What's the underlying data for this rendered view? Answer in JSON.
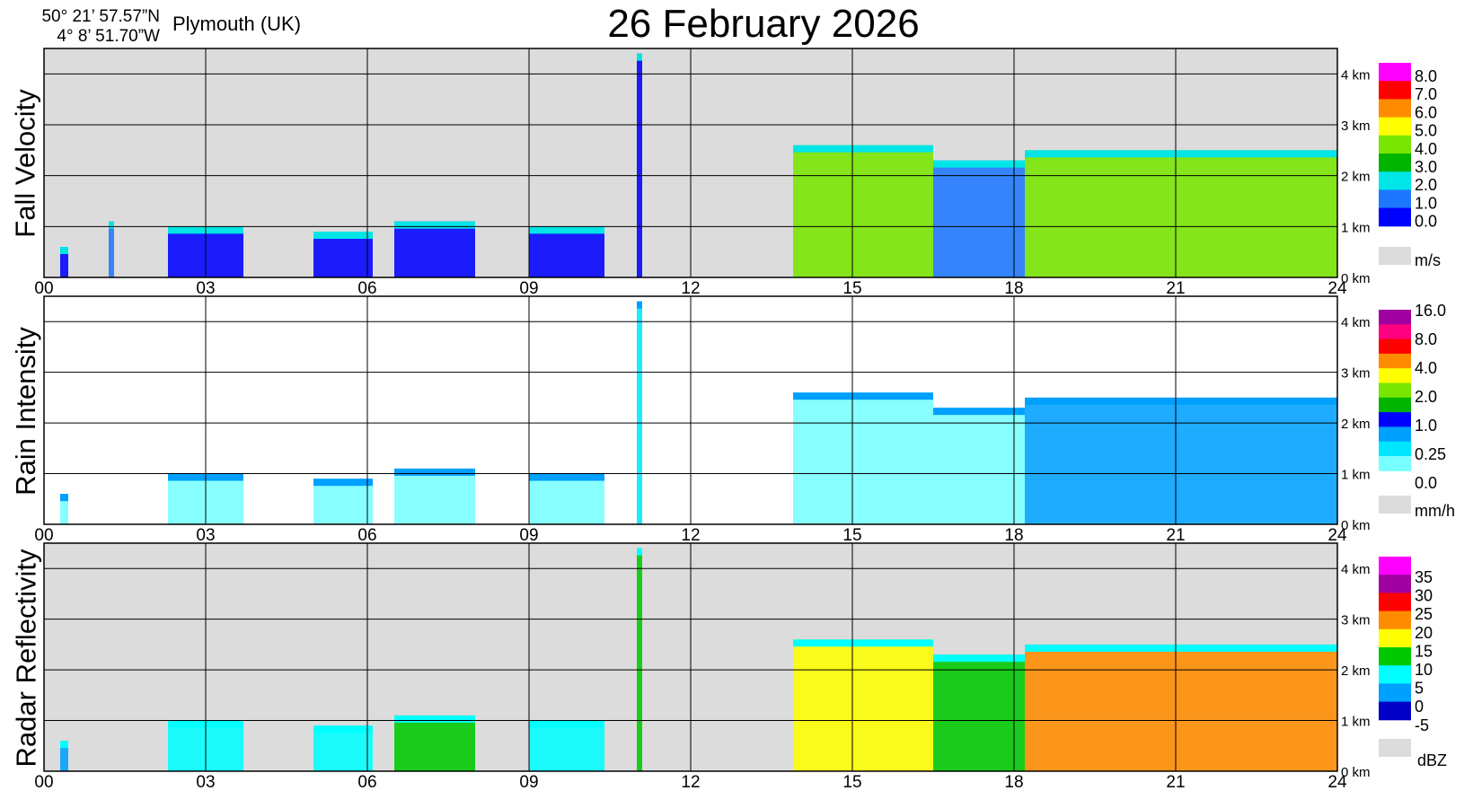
{
  "header": {
    "lat": "50° 21’ 57.57”N",
    "lon": "4°  8’ 51.70”W",
    "location": "Plymouth (UK)",
    "date": "26 February  2026"
  },
  "x_ticks": [
    "00",
    "03",
    "06",
    "09",
    "12",
    "15",
    "18",
    "21",
    "24"
  ],
  "height_ticks": [
    "0 km",
    "1 km",
    "2 km",
    "3 km",
    "4 km"
  ],
  "chart_data": [
    {
      "type": "heatmap",
      "ylabel": "Fall Velocity",
      "xlim": [
        0,
        24
      ],
      "ylim": [
        0,
        4.5
      ],
      "background": "#dcdcdc",
      "colorbar": {
        "unit": "m/s",
        "colors": [
          "#0000ff",
          "#1e78ff",
          "#00e6e6",
          "#00b400",
          "#78e600",
          "#ffff00",
          "#ff8c00",
          "#ff0000",
          "#ff00ff"
        ],
        "labels": [
          "0.0",
          "1.0",
          "2.0",
          "3.0",
          "4.0",
          "5.0",
          "6.0",
          "7.0",
          "8.0"
        ]
      },
      "precip_events": [
        {
          "start": 0.3,
          "end": 0.45,
          "top": 0.6,
          "value": 0.5
        },
        {
          "start": 1.2,
          "end": 1.3,
          "top": 1.1,
          "value": 1.0
        },
        {
          "start": 2.3,
          "end": 3.7,
          "top": 1.0,
          "value": 0.5
        },
        {
          "start": 5.0,
          "end": 6.1,
          "top": 0.9,
          "value": 0.5
        },
        {
          "start": 6.5,
          "end": 8.0,
          "top": 1.1,
          "value": 0.5
        },
        {
          "start": 9.0,
          "end": 10.4,
          "top": 1.0,
          "value": 0.5
        },
        {
          "start": 11.0,
          "end": 11.1,
          "top": 4.4,
          "value": 0.5
        },
        {
          "start": 13.9,
          "end": 16.5,
          "top": 2.6,
          "value": 4.5
        },
        {
          "start": 16.5,
          "end": 18.2,
          "top": 2.3,
          "value": 1.0
        },
        {
          "start": 18.2,
          "end": 24.0,
          "top": 2.5,
          "value": 4.5
        }
      ]
    },
    {
      "type": "heatmap",
      "ylabel": "Rain Intensity",
      "xlim": [
        0,
        24
      ],
      "ylim": [
        0,
        4.5
      ],
      "background": "#ffffff",
      "colorbar": {
        "unit": "mm/h",
        "colors": [
          "#78ffff",
          "#00e6ff",
          "#00a0ff",
          "#0000ff",
          "#00b400",
          "#78e600",
          "#ffff00",
          "#ff8c00",
          "#ff0000",
          "#ff0080",
          "#a000a0"
        ],
        "labels": [
          "0.0",
          "0.25",
          "1.0",
          "2.0",
          "4.0",
          "8.0",
          "16.0"
        ]
      },
      "precip_events": [
        {
          "start": 0.3,
          "end": 0.45,
          "top": 0.6,
          "value": 0.1
        },
        {
          "start": 2.3,
          "end": 3.7,
          "top": 1.0,
          "value": 0.2
        },
        {
          "start": 5.0,
          "end": 6.1,
          "top": 0.9,
          "value": 0.2
        },
        {
          "start": 6.5,
          "end": 8.0,
          "top": 1.1,
          "value": 0.5
        },
        {
          "start": 9.0,
          "end": 10.4,
          "top": 1.0,
          "value": 0.2
        },
        {
          "start": 11.0,
          "end": 11.1,
          "top": 4.4,
          "value": 2.0
        },
        {
          "start": 13.9,
          "end": 16.5,
          "top": 2.6,
          "value": 0.8
        },
        {
          "start": 16.5,
          "end": 18.2,
          "top": 2.3,
          "value": 1.5
        },
        {
          "start": 18.2,
          "end": 24.0,
          "top": 2.5,
          "value": 4.0
        }
      ]
    },
    {
      "type": "heatmap",
      "ylabel": "Radar Reflectivity",
      "xlim": [
        0,
        24
      ],
      "ylim": [
        0,
        4.5
      ],
      "background": "#dcdcdc",
      "colorbar": {
        "unit": "dBZ",
        "colors": [
          "#0000c8",
          "#00a0ff",
          "#00ffff",
          "#00c800",
          "#ffff00",
          "#ff8c00",
          "#ff0000",
          "#a000a0",
          "#ff00ff"
        ],
        "labels": [
          "-5",
          "0",
          "5",
          "10",
          "15",
          "20",
          "25",
          "30",
          "35"
        ]
      },
      "precip_events": [
        {
          "start": 0.3,
          "end": 0.45,
          "top": 0.6,
          "value": 0
        },
        {
          "start": 2.3,
          "end": 3.7,
          "top": 1.0,
          "value": 5
        },
        {
          "start": 5.0,
          "end": 6.1,
          "top": 0.9,
          "value": 5
        },
        {
          "start": 6.5,
          "end": 8.0,
          "top": 1.1,
          "value": 10
        },
        {
          "start": 9.0,
          "end": 10.4,
          "top": 1.0,
          "value": 5
        },
        {
          "start": 11.0,
          "end": 11.1,
          "top": 4.4,
          "value": 10
        },
        {
          "start": 13.9,
          "end": 16.5,
          "top": 2.6,
          "value": 15
        },
        {
          "start": 16.5,
          "end": 18.2,
          "top": 2.3,
          "value": 10
        },
        {
          "start": 18.2,
          "end": 24.0,
          "top": 2.5,
          "value": 20
        }
      ]
    }
  ]
}
